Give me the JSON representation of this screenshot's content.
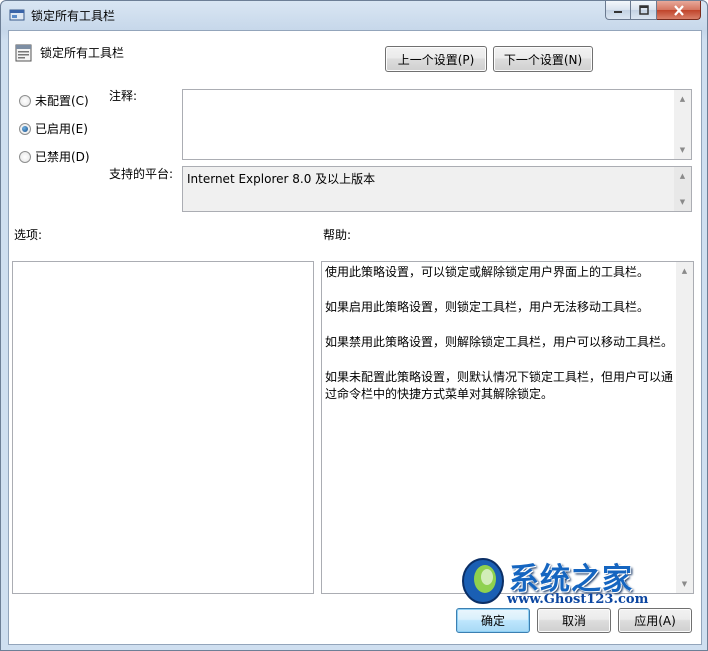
{
  "window": {
    "title": "锁定所有工具栏"
  },
  "policy": {
    "name": "锁定所有工具栏"
  },
  "nav": {
    "prev_label": "上一个设置(P)",
    "next_label": "下一个设置(N)"
  },
  "state": {
    "options": [
      {
        "label": "未配置(C)",
        "checked": false
      },
      {
        "label": "已启用(E)",
        "checked": true
      },
      {
        "label": "已禁用(D)",
        "checked": false
      }
    ]
  },
  "comment": {
    "label": "注释:",
    "value": ""
  },
  "platform": {
    "label": "支持的平台:",
    "value": "Internet Explorer 8.0 及以上版本"
  },
  "options_section": {
    "label": "选项:"
  },
  "help_section": {
    "label": "帮助:",
    "paragraphs": [
      "使用此策略设置，可以锁定或解除锁定用户界面上的工具栏。",
      "如果启用此策略设置，则锁定工具栏，用户无法移动工具栏。",
      "如果禁用此策略设置，则解除锁定工具栏，用户可以移动工具栏。",
      "如果未配置此策略设置，则默认情况下锁定工具栏，但用户可以通过命令栏中的快捷方式菜单对其解除锁定。"
    ]
  },
  "footer": {
    "ok_label": "确定",
    "cancel_label": "取消",
    "apply_label": "应用(A)"
  },
  "watermark": {
    "brand": "系统之家",
    "url": "www.Ghost123.com"
  }
}
